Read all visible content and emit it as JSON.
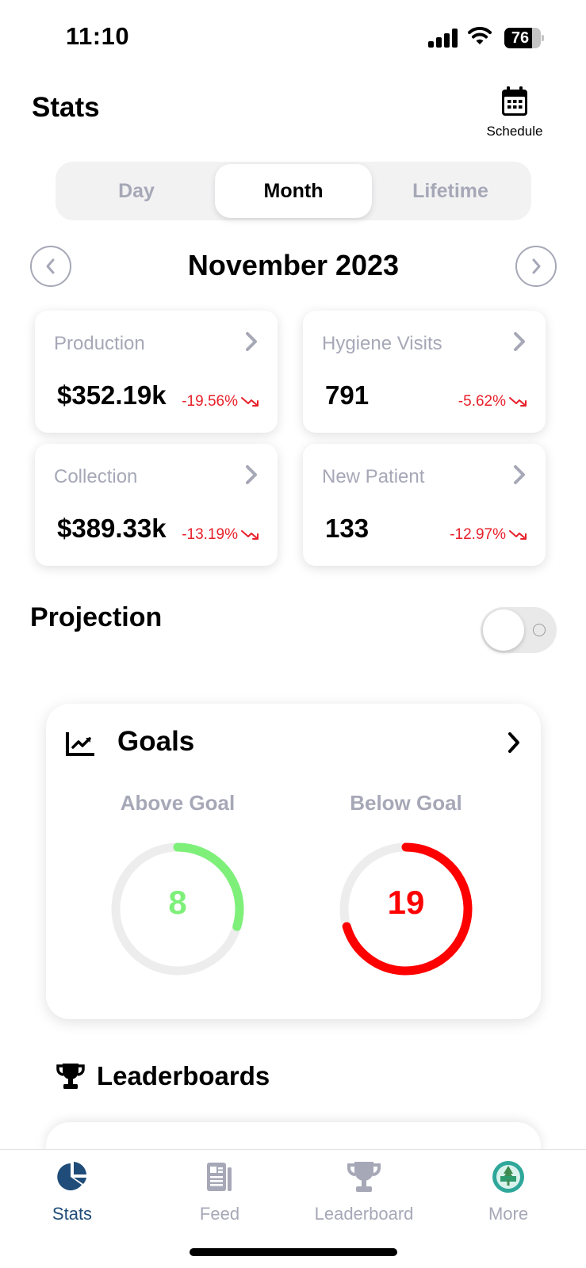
{
  "status_bar": {
    "time": "11:10",
    "battery_percent": 76,
    "battery_label": "76",
    "icons": [
      "cellular-signal-icon",
      "wifi-icon",
      "battery-icon"
    ]
  },
  "header": {
    "title": "Stats",
    "schedule_label": "Schedule",
    "schedule_icon": "calendar-icon"
  },
  "period_tabs": {
    "items": [
      {
        "label": "Day",
        "active": false
      },
      {
        "label": "Month",
        "active": true
      },
      {
        "label": "Lifetime",
        "active": false
      }
    ]
  },
  "month_nav": {
    "title": "November 2023",
    "prev_icon": "chevron-left-icon",
    "next_icon": "chevron-right-icon"
  },
  "metrics": [
    {
      "label": "Production",
      "value": "$352.19k",
      "change": "-19.56%",
      "trend": "down"
    },
    {
      "label": "Hygiene Visits",
      "value": "791",
      "change": "-5.62%",
      "trend": "down"
    },
    {
      "label": "Collection",
      "value": "$389.33k",
      "change": "-13.19%",
      "trend": "down"
    },
    {
      "label": "New Patient",
      "value": "133",
      "change": "-12.97%",
      "trend": "down"
    }
  ],
  "projection": {
    "title": "Projection",
    "toggle_on": false
  },
  "goals": {
    "title": "Goals",
    "icon": "chart-line-icon",
    "above": {
      "label": "Above Goal",
      "value": "8",
      "count": 8,
      "fraction": 0.296,
      "color": "#7ef07a"
    },
    "below": {
      "label": "Below Goal",
      "value": "19",
      "count": 19,
      "fraction": 0.704,
      "color": "#ff0000"
    },
    "track_color": "#ededed"
  },
  "leaderboards": {
    "title": "Leaderboards",
    "icon": "trophy-icon"
  },
  "tab_bar": {
    "items": [
      {
        "label": "Stats",
        "icon": "pie-chart-icon",
        "active": true
      },
      {
        "label": "Feed",
        "icon": "newspaper-icon",
        "active": false
      },
      {
        "label": "Leaderboard",
        "icon": "trophy-icon",
        "active": false
      },
      {
        "label": "More",
        "icon": "practice-logo-icon",
        "active": false
      }
    ]
  },
  "colors": {
    "accent": "#1f4c79",
    "muted": "#a6a8b7",
    "negative": "#e8202a"
  }
}
